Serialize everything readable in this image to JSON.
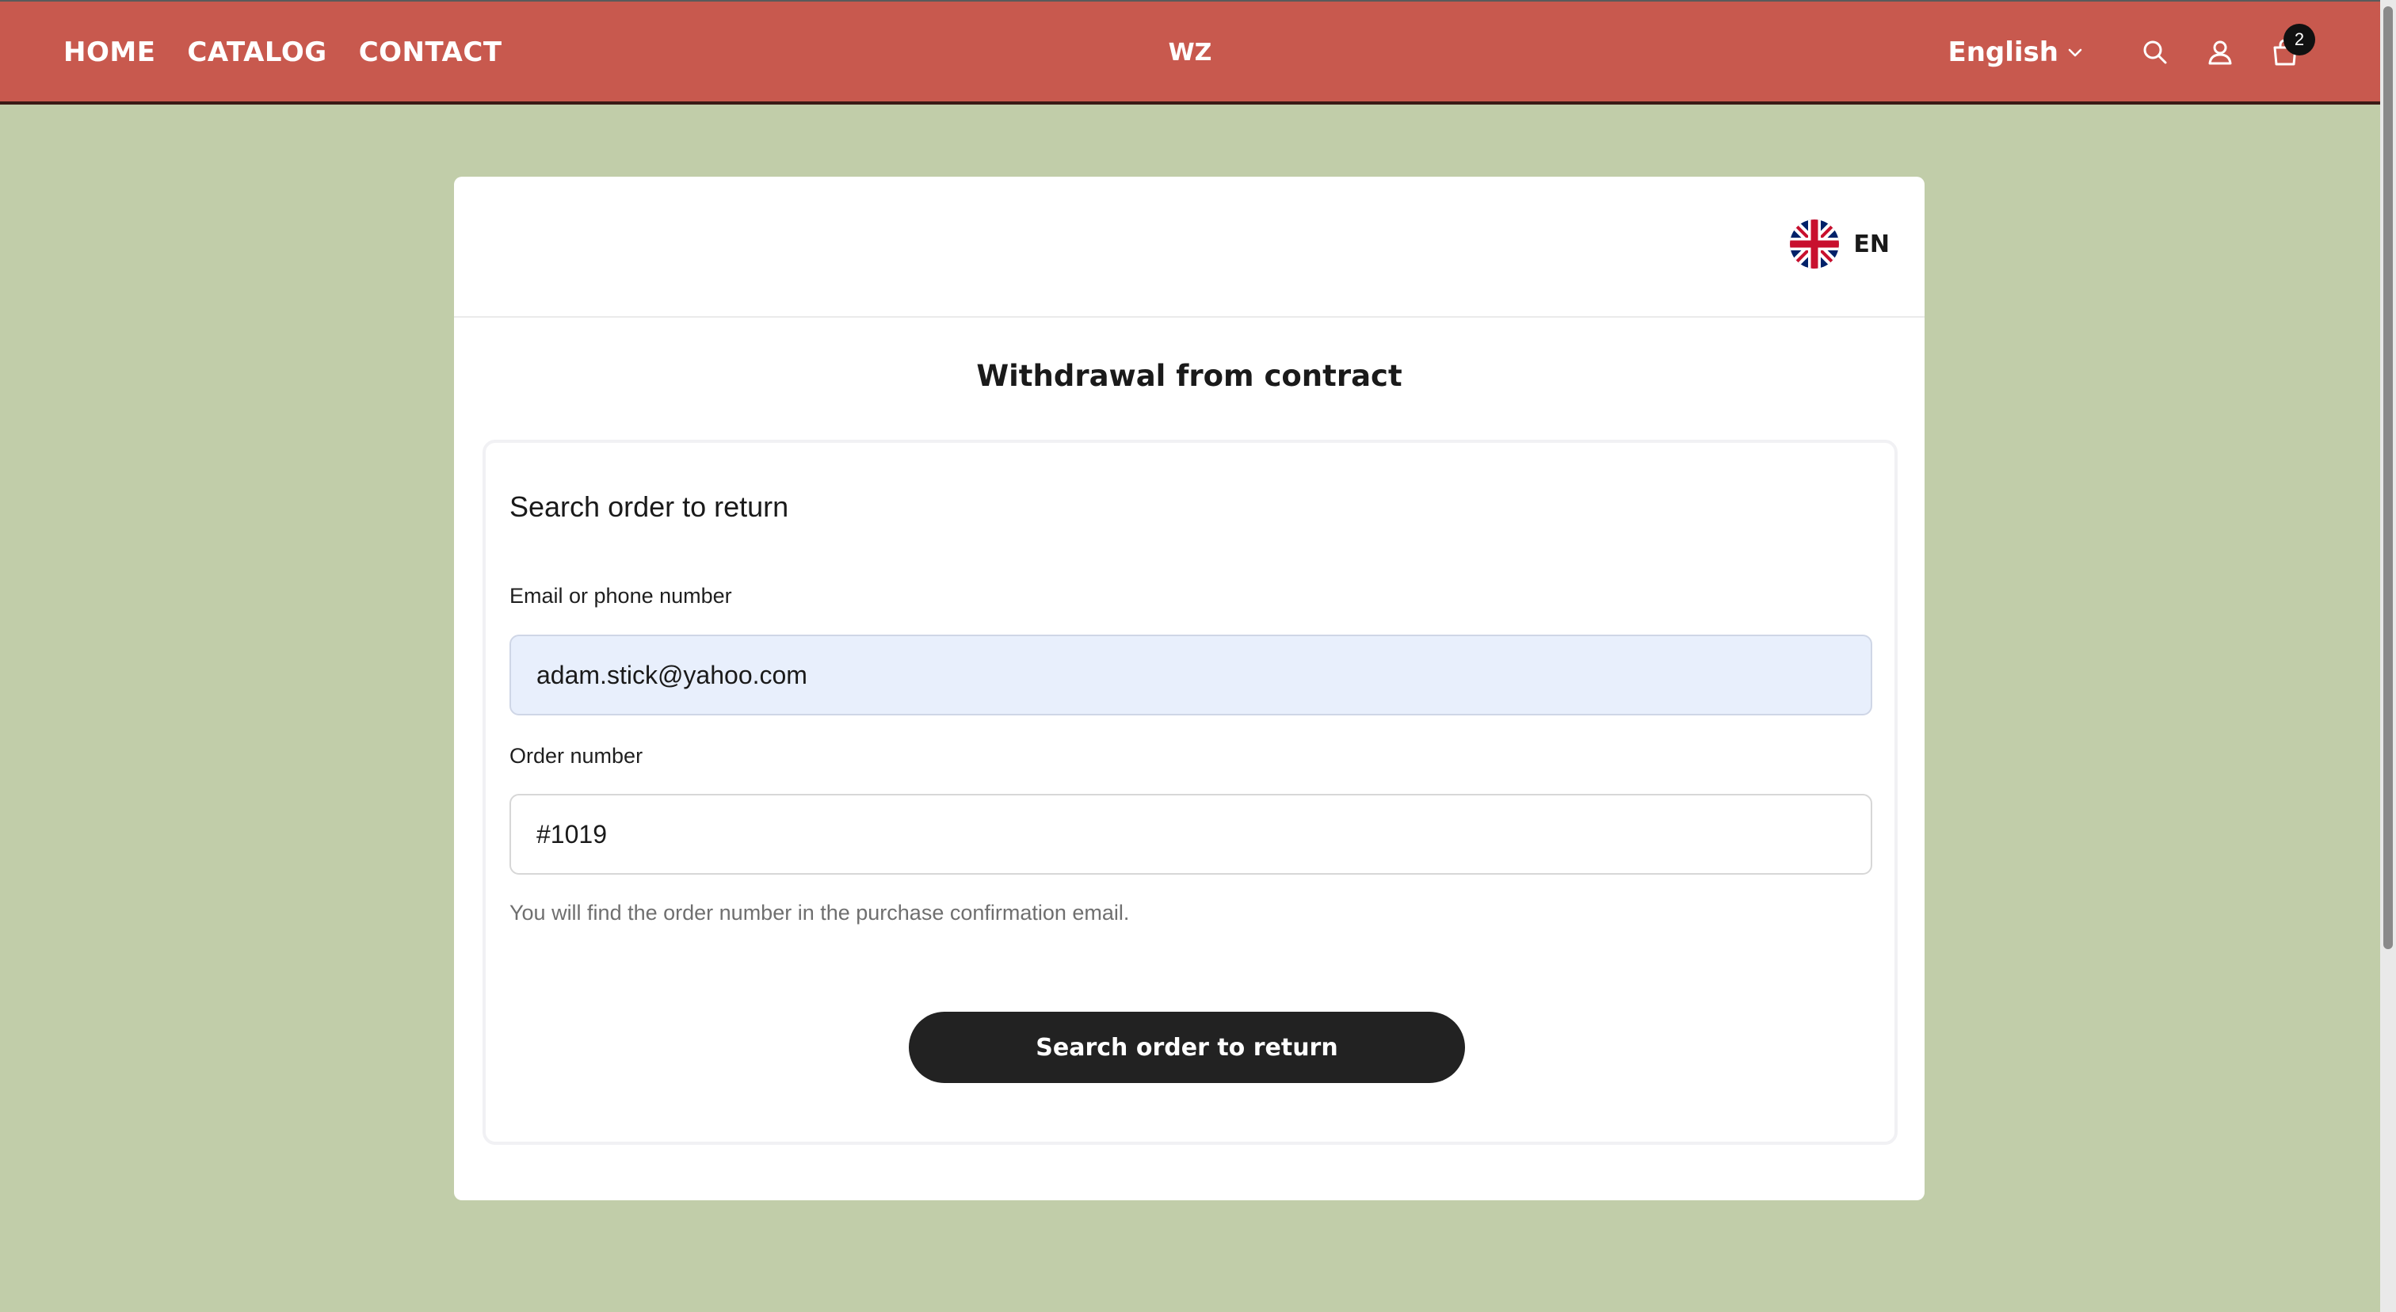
{
  "header": {
    "nav": [
      "HOME",
      "CATALOG",
      "CONTACT"
    ],
    "logo": "WZ",
    "language": "English",
    "cart_count": "2"
  },
  "card": {
    "lang_code": "EN",
    "title": "Withdrawal from contract",
    "form": {
      "heading": "Search order to return",
      "email_label": "Email or phone number",
      "email_value": "adam.stick@yahoo.com",
      "order_label": "Order number",
      "order_value": "#1019",
      "hint": "You will find the order number in the purchase confirmation email.",
      "submit_label": "Search order to return"
    }
  },
  "colors": {
    "header_bg": "#c8594e",
    "page_bg": "#c1cda9",
    "button_bg": "#222222",
    "autofill_bg": "#e8effc"
  },
  "icons": {
    "language": "chevron-down-icon",
    "search": "search-icon",
    "account": "user-icon",
    "cart": "shopping-bag-icon",
    "flag": "uk-flag-icon"
  }
}
